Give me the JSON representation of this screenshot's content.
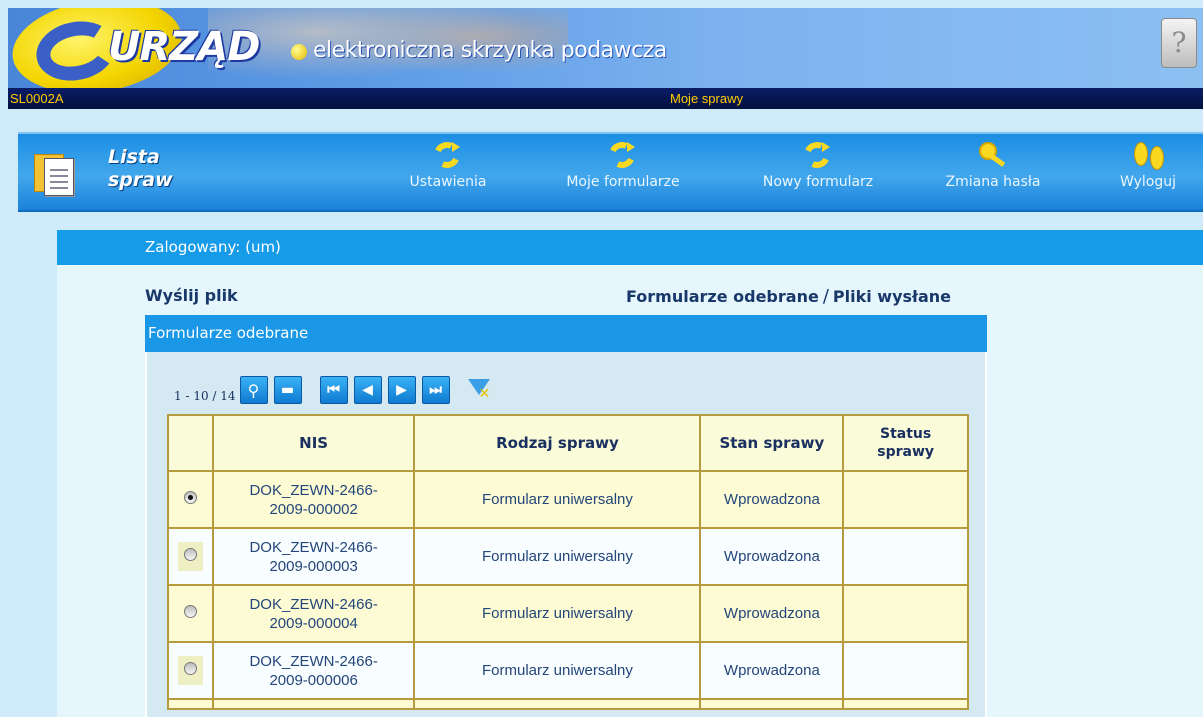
{
  "header": {
    "logo_text": "URZĄD",
    "subtitle": "elektroniczna skrzynka podawcza",
    "help_symbol": "?"
  },
  "statusbar": {
    "code": "SL0002A",
    "title": "Moje sprawy"
  },
  "toolbar": {
    "list_title_line1": "Lista",
    "list_title_line2": "spraw",
    "items": [
      {
        "label": "Ustawienia",
        "icon": "refresh-icon"
      },
      {
        "label": "Moje formularze",
        "icon": "refresh-icon"
      },
      {
        "label": "Nowy formularz",
        "icon": "refresh-icon"
      },
      {
        "label": "Zmiana hasła",
        "icon": "key-icon"
      },
      {
        "label": "Wyloguj",
        "icon": "footsteps-icon"
      }
    ]
  },
  "panel": {
    "logged_in": "Zalogowany: (um)",
    "send_file": "Wyślij plik",
    "received_link": "Formularze odebrane",
    "separator": "/",
    "sent_link": "Pliki wysłane",
    "section_title": "Formularze odebrane"
  },
  "pager": {
    "count": "1 - 10 / 14",
    "buttons": [
      "search",
      "collapse",
      "first",
      "previous",
      "next",
      "last"
    ]
  },
  "table": {
    "columns": [
      "NIS",
      "Rodzaj sprawy",
      "Stan sprawy",
      "Status sprawy"
    ],
    "status_header_line1": "Status",
    "status_header_line2": "sprawy",
    "rows": [
      {
        "nis_line1": "DOK_ZEWN-2466-",
        "nis_line2": "2009-000002",
        "type": "Formularz uniwersalny",
        "state": "Wprowadzona",
        "status": "",
        "selected": true
      },
      {
        "nis_line1": "DOK_ZEWN-2466-",
        "nis_line2": "2009-000003",
        "type": "Formularz uniwersalny",
        "state": "Wprowadzona",
        "status": "",
        "selected": false
      },
      {
        "nis_line1": "DOK_ZEWN-2466-",
        "nis_line2": "2009-000004",
        "type": "Formularz uniwersalny",
        "state": "Wprowadzona",
        "status": "",
        "selected": false
      },
      {
        "nis_line1": "DOK_ZEWN-2466-",
        "nis_line2": "2009-000006",
        "type": "Formularz uniwersalny",
        "state": "Wprowadzona",
        "status": "",
        "selected": false
      }
    ]
  }
}
